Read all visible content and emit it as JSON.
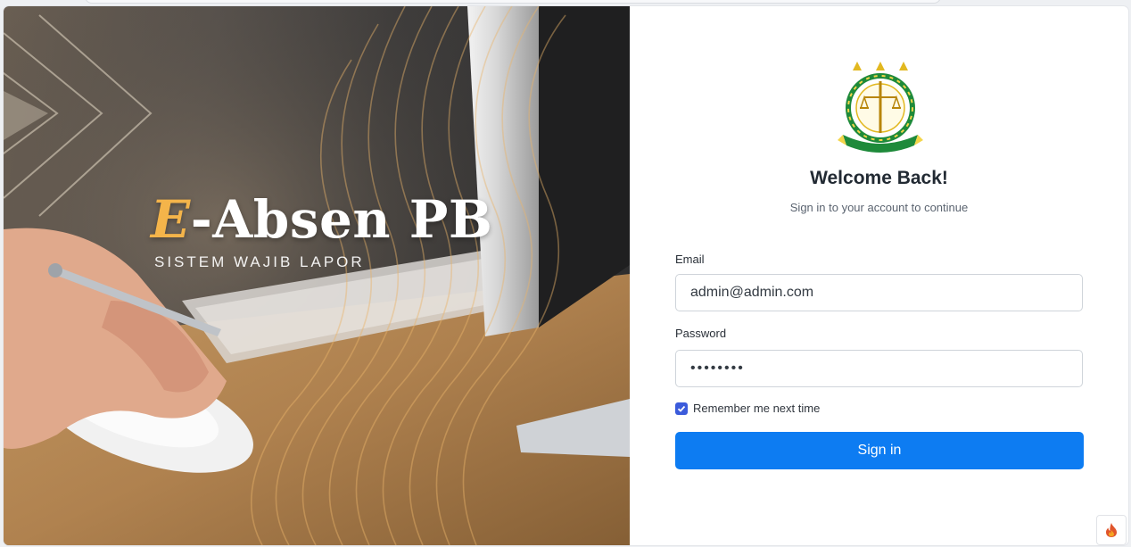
{
  "brand": {
    "title_accent": "E",
    "title_rest": "-Absen PB",
    "subtitle": "SISTEM WAJIB LAPOR"
  },
  "login": {
    "logo_icon": "prosecutor-emblem-icon",
    "heading": "Welcome Back!",
    "subheading": "Sign in to your account to continue",
    "email_label": "Email",
    "email_value": "admin@admin.com",
    "password_label": "Password",
    "password_value": "password",
    "remember_label": "Remember me next time",
    "remember_checked": true,
    "submit_label": "Sign in"
  },
  "colors": {
    "accent": "#f4b44a",
    "primary_button": "#0d7cf2",
    "checkbox": "#3b5bdb"
  },
  "debug_toolbar": {
    "icon": "flame-icon"
  }
}
